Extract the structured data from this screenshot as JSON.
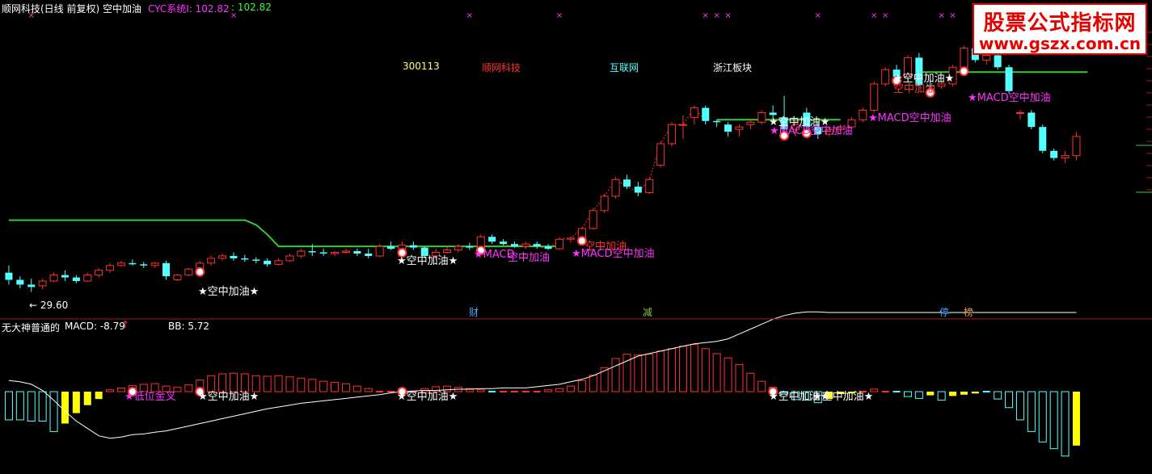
{
  "header": {
    "title": "顺网科技(日线 前复权) 空中加油",
    "cyc_label": "CYC系统I: 102.82",
    "cyc_value2": ": 102.82"
  },
  "info": {
    "code": "300113",
    "name": "顺网科技",
    "sector": "互联网",
    "region": "浙江板块"
  },
  "watermark": {
    "line1": "股票公式指标网",
    "line2": "www.gszx.com.cn"
  },
  "low_label": "← 29.60",
  "badges": [
    {
      "text": "财",
      "color": "#4aa8ff"
    },
    {
      "text": "减",
      "color": "#7ec850"
    },
    {
      "text": "停",
      "color": "#4aa8ff"
    },
    {
      "text": "榜",
      "color": "#e0a060"
    }
  ],
  "signals": {
    "refuel": "★空中加油★",
    "refuel_plain": "空中加油",
    "macd_refuel": "★MACD空中加油",
    "macd_refuel_short": "★MACD",
    "low_gold": "★低位金叉"
  },
  "lower": {
    "name": "无大神普通的",
    "macd_label": "MACD: -8.79",
    "macd_arrow": "↑",
    "bb_label": "BB: 5.72"
  },
  "colors": {
    "up": "#ff3030",
    "down": "#54ffff",
    "green_line": "#33cc33",
    "yellow": "#ffff00",
    "magenta": "#ff33ff",
    "white_line": "#ffffff"
  },
  "chart_data": [
    {
      "type": "candlestick",
      "title": "顺网科技(日线 前复权) 空中加油",
      "candles": [
        [
          31.2,
          31.8,
          30.2,
          30.6
        ],
        [
          30.6,
          30.9,
          29.9,
          30.2
        ],
        [
          30.2,
          30.7,
          29.6,
          30.0
        ],
        [
          30.1,
          30.7,
          29.8,
          30.5
        ],
        [
          30.5,
          31.2,
          30.4,
          31.0
        ],
        [
          31.0,
          31.4,
          30.5,
          30.8
        ],
        [
          30.8,
          31.0,
          30.3,
          30.5
        ],
        [
          30.5,
          31.2,
          30.4,
          31.0
        ],
        [
          31.0,
          31.6,
          30.8,
          31.4
        ],
        [
          31.4,
          32.0,
          31.2,
          31.8
        ],
        [
          31.8,
          32.2,
          31.7,
          32.0
        ],
        [
          32.0,
          32.3,
          31.8,
          31.9
        ],
        [
          31.9,
          32.1,
          31.6,
          31.8
        ],
        [
          31.8,
          32.1,
          31.6,
          32.0
        ],
        [
          32.0,
          32.2,
          30.6,
          30.9
        ],
        [
          30.6,
          31.1,
          30.5,
          31.0
        ],
        [
          31.0,
          31.6,
          30.9,
          31.5
        ],
        [
          31.5,
          32.2,
          31.4,
          32.0
        ],
        [
          32.0,
          32.6,
          31.8,
          32.4
        ],
        [
          32.4,
          32.8,
          32.2,
          32.6
        ],
        [
          32.6,
          32.9,
          32.2,
          32.4
        ],
        [
          32.4,
          32.7,
          32.1,
          32.3
        ],
        [
          32.3,
          32.5,
          32.0,
          32.2
        ],
        [
          32.2,
          32.4,
          31.7,
          31.9
        ],
        [
          31.9,
          32.4,
          31.8,
          32.2
        ],
        [
          32.2,
          32.8,
          32.1,
          32.6
        ],
        [
          32.6,
          33.2,
          32.4,
          33.0
        ],
        [
          33.0,
          33.6,
          32.6,
          32.9
        ],
        [
          32.9,
          33.2,
          32.6,
          32.8
        ],
        [
          32.8,
          33.0,
          32.6,
          32.9
        ],
        [
          32.9,
          33.2,
          32.8,
          33.0
        ],
        [
          33.0,
          33.2,
          32.6,
          32.8
        ],
        [
          32.8,
          33.2,
          32.4,
          32.6
        ],
        [
          32.6,
          33.6,
          32.5,
          33.4
        ],
        [
          33.4,
          33.8,
          33.1,
          33.2
        ],
        [
          33.2,
          33.8,
          33.0,
          33.5
        ],
        [
          33.5,
          33.8,
          33.1,
          33.3
        ],
        [
          33.3,
          33.4,
          32.4,
          32.6
        ],
        [
          32.6,
          33.2,
          32.3,
          32.9
        ],
        [
          32.9,
          33.4,
          32.8,
          33.1
        ],
        [
          33.1,
          33.6,
          32.9,
          33.4
        ],
        [
          33.4,
          33.7,
          33.1,
          33.3
        ],
        [
          33.3,
          34.4,
          33.2,
          34.2
        ],
        [
          34.2,
          34.4,
          33.6,
          33.8
        ],
        [
          33.8,
          34.0,
          33.5,
          33.6
        ],
        [
          33.6,
          33.8,
          33.3,
          33.4
        ],
        [
          33.4,
          33.8,
          33.2,
          33.6
        ],
        [
          33.6,
          33.8,
          33.2,
          33.4
        ],
        [
          33.4,
          33.6,
          33.1,
          33.2
        ],
        [
          33.2,
          34.2,
          33.1,
          34.0
        ],
        [
          34.0,
          34.2,
          33.7,
          34.1
        ],
        [
          34.1,
          35.0,
          34.0,
          34.9
        ],
        [
          34.9,
          36.6,
          34.8,
          36.4
        ],
        [
          36.4,
          37.8,
          36.2,
          37.6
        ],
        [
          37.6,
          39.2,
          37.4,
          39.0
        ],
        [
          39.0,
          39.4,
          38.2,
          38.4
        ],
        [
          38.4,
          38.8,
          37.6,
          37.9
        ],
        [
          37.9,
          39.2,
          37.8,
          39.0
        ],
        [
          40.2,
          42.2,
          40.0,
          42.0
        ],
        [
          42.0,
          43.8,
          41.8,
          43.6
        ],
        [
          43.6,
          44.4,
          42.4,
          43.6
        ],
        [
          44.2,
          45.2,
          43.6,
          45.0
        ],
        [
          45.0,
          45.2,
          43.6,
          43.9
        ],
        [
          43.9,
          44.0,
          43.4,
          43.8
        ],
        [
          43.6,
          43.8,
          42.6,
          43.0
        ],
        [
          43.2,
          43.6,
          42.6,
          43.4
        ],
        [
          43.6,
          44.0,
          43.2,
          43.8
        ],
        [
          43.8,
          44.8,
          43.6,
          44.6
        ],
        [
          44.6,
          45.2,
          44.0,
          44.4
        ],
        [
          44.2,
          46.0,
          42.8,
          43.2
        ],
        [
          43.2,
          44.0,
          42.6,
          43.6
        ],
        [
          44.6,
          45.0,
          43.0,
          43.4
        ],
        [
          43.4,
          43.8,
          42.4,
          42.8
        ],
        [
          42.8,
          43.4,
          42.6,
          43.2
        ],
        [
          43.2,
          43.6,
          43.0,
          43.4
        ],
        [
          43.4,
          44.2,
          43.2,
          44.0
        ],
        [
          44.0,
          45.0,
          43.8,
          44.8
        ],
        [
          44.8,
          47.2,
          44.6,
          47.0
        ],
        [
          47.0,
          48.4,
          46.8,
          48.2
        ],
        [
          48.2,
          48.6,
          47.4,
          47.6
        ],
        [
          47.6,
          49.4,
          47.4,
          49.2
        ],
        [
          49.2,
          49.6,
          46.6,
          46.9
        ],
        [
          46.9,
          47.4,
          46.4,
          46.8
        ],
        [
          46.8,
          47.2,
          46.6,
          47.0
        ],
        [
          47.0,
          48.6,
          46.8,
          48.4
        ],
        [
          48.4,
          50.2,
          48.2,
          50.0
        ],
        [
          50.0,
          50.4,
          48.8,
          49.0
        ],
        [
          49.0,
          49.6,
          48.6,
          49.4
        ],
        [
          49.4,
          49.6,
          48.2,
          48.4
        ],
        [
          48.4,
          48.6,
          46.2,
          46.4
        ],
        [
          44.6,
          44.8,
          44.0,
          44.6
        ],
        [
          44.6,
          44.8,
          43.2,
          43.4
        ],
        [
          43.4,
          43.6,
          41.2,
          41.4
        ],
        [
          41.4,
          41.6,
          40.6,
          40.8
        ],
        [
          40.8,
          41.4,
          40.4,
          41.0
        ],
        [
          41.0,
          43.0,
          40.6,
          42.6
        ]
      ],
      "green_line": [
        35.6,
        35.6,
        35.6,
        35.6,
        35.6,
        35.6,
        35.6,
        35.6,
        35.6,
        35.6,
        35.6,
        35.6,
        35.6,
        35.6,
        35.6,
        35.6,
        35.6,
        35.6,
        35.6,
        35.6,
        35.6,
        35.6,
        35.2,
        34.4,
        33.4,
        33.4,
        33.4,
        33.4,
        33.4,
        33.4,
        33.4,
        33.4,
        33.4,
        33.4,
        33.4,
        33.4,
        33.4,
        33.4,
        33.4,
        33.4,
        33.4,
        33.4,
        33.4,
        33.4,
        33.4,
        33.4,
        33.4,
        33.4,
        33.4,
        33.4,
        null,
        null,
        null,
        null,
        null,
        null,
        null,
        null,
        null,
        null,
        null,
        null,
        null,
        44.0,
        44.0,
        44.0,
        44.0,
        44.0,
        44.0,
        44.0,
        44.0,
        44.0,
        44.0,
        44.0,
        44.0,
        null,
        null,
        null,
        null,
        null,
        null,
        48.0,
        48.0,
        48.0,
        48.0,
        48.0,
        48.0,
        48.0,
        48.0,
        48.0,
        48.0,
        48.0,
        48.0,
        48.0,
        48.0,
        48.0,
        48.0
      ],
      "low_marker": 29.6
    },
    {
      "type": "bar",
      "title": "MACD",
      "macd_bars": [
        -4.6,
        -4.6,
        -4.8,
        -4.8,
        -6.5,
        -5.2,
        -3.5,
        -2.2,
        -1.2,
        0.3,
        0.6,
        1.0,
        1.2,
        1.3,
        0.9,
        0.7,
        1.1,
        1.9,
        2.6,
        2.9,
        3.0,
        2.9,
        2.6,
        2.5,
        2.6,
        2.4,
        2.2,
        2.0,
        1.7,
        1.5,
        1.3,
        0.9,
        0.5,
        0.2,
        0.1,
        0.1,
        0.2,
        0.5,
        0.8,
        0.9,
        0.7,
        0.5,
        0.3,
        -0.2,
        0.1,
        0.2,
        0.1,
        0.1,
        0.3,
        0.5,
        0.9,
        1.8,
        2.7,
        3.9,
        5.4,
        6.1,
        6.0,
        6.1,
        6.6,
        7.0,
        7.4,
        7.7,
        7.0,
        6.2,
        5.5,
        4.4,
        3.0,
        1.7,
        0.7,
        -0.4,
        -1.3,
        -1.4,
        -1.8,
        -1.2,
        -0.4,
        -0.3,
        0.1,
        0.4,
        0.1,
        -0.1,
        -0.8,
        -1.1,
        -0.6,
        -1.4,
        -0.7,
        -0.5,
        -0.3,
        -0.1,
        -1.2,
        -2.6,
        -4.6,
        -6.5,
        -8.2,
        -9.3,
        -10.5,
        -8.79
      ],
      "bb_line": [
        1.8,
        1.6,
        1.2,
        0.2,
        -1.4,
        -3.2,
        -4.8,
        -6.0,
        -7.2,
        -7.6,
        -7.4,
        -7.0,
        -6.9,
        -6.6,
        -6.4,
        -6.0,
        -5.6,
        -5.2,
        -4.8,
        -4.4,
        -4.0,
        -3.6,
        -3.2,
        -2.8,
        -2.5,
        -2.2,
        -1.9,
        -1.7,
        -1.5,
        -1.3,
        -1.1,
        -0.9,
        -0.7,
        -0.5,
        -0.2,
        0.0,
        0.1,
        0.2,
        0.2,
        0.3,
        0.4,
        0.4,
        0.5,
        0.5,
        0.6,
        0.6,
        0.6,
        0.8,
        1.0,
        1.2,
        1.6,
        2.0,
        2.6,
        3.4,
        4.2,
        5.0,
        5.8,
        6.2,
        6.6,
        7.0,
        7.4,
        7.8,
        8.0,
        8.2,
        8.6,
        9.4,
        10.2,
        11.0,
        11.8,
        12.4,
        12.8,
        13.0,
        13.0,
        12.9,
        12.9,
        12.9,
        12.9,
        12.9,
        12.9,
        12.9,
        12.9,
        12.9,
        12.9,
        12.9,
        12.9,
        12.9,
        12.9,
        12.9,
        12.9,
        12.9,
        12.9,
        12.9,
        12.9,
        12.9,
        12.9,
        12.9
      ]
    }
  ]
}
